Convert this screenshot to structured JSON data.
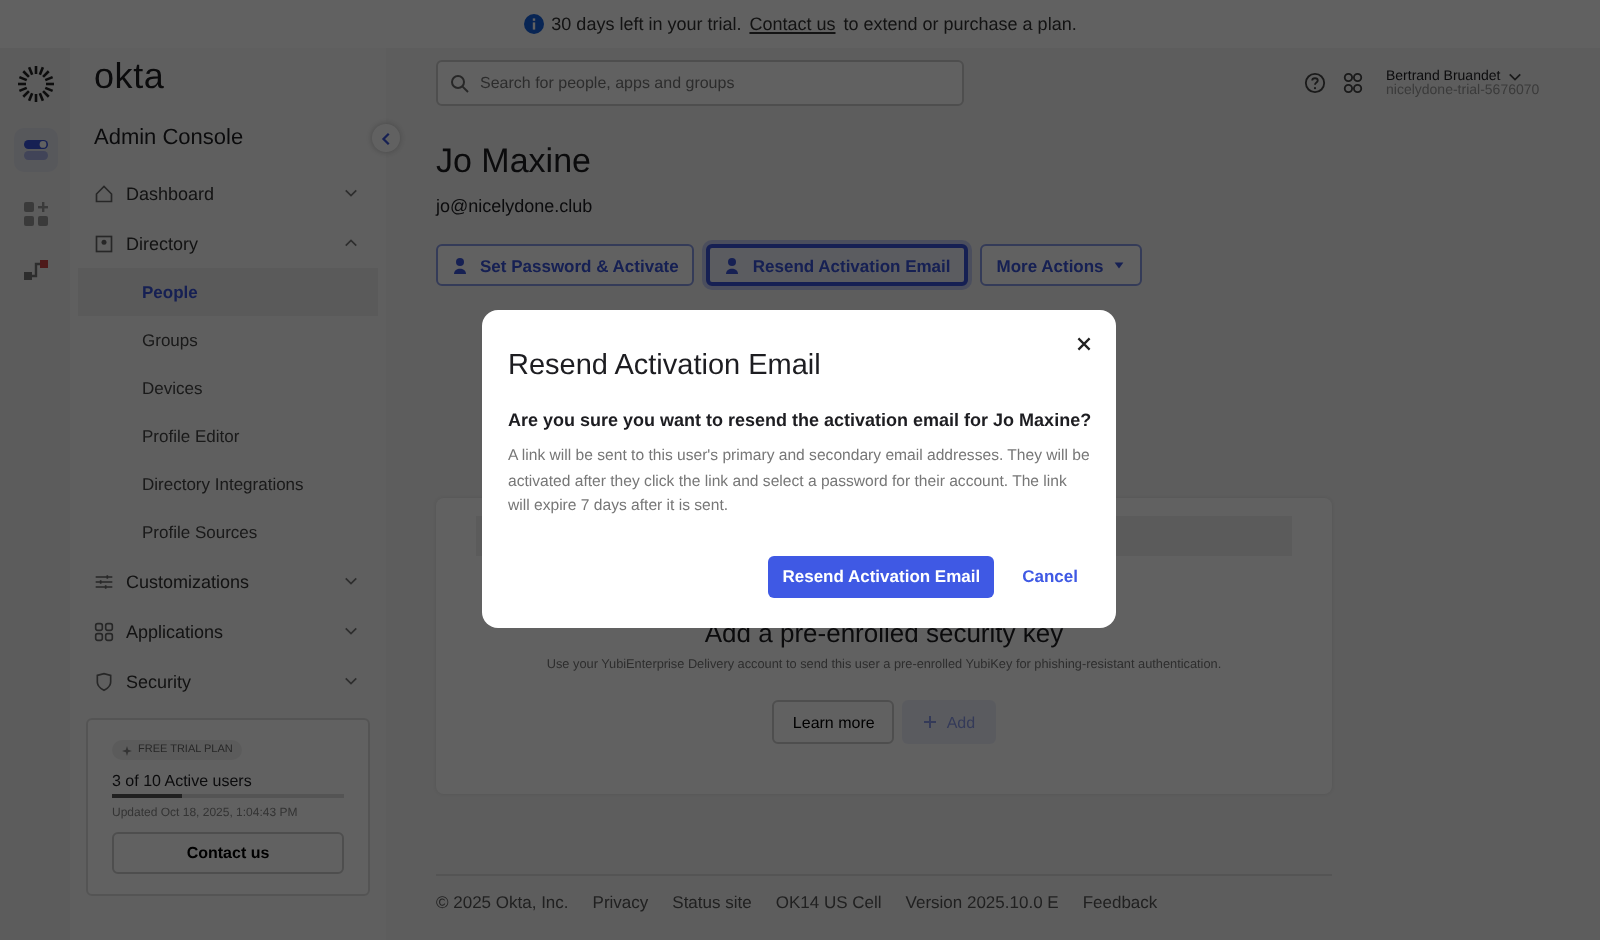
{
  "banner": {
    "text": "30 days left in your trial.",
    "link": "Contact us",
    "tail": "to extend or purchase a plan."
  },
  "brand": {
    "logo": "okta",
    "console": "Admin Console"
  },
  "nav": [
    {
      "label": "Dashboard",
      "expanded": false
    },
    {
      "label": "Directory",
      "expanded": true,
      "children": [
        {
          "label": "People",
          "selected": true
        },
        {
          "label": "Groups",
          "selected": false
        },
        {
          "label": "Devices",
          "selected": false
        },
        {
          "label": "Profile Editor",
          "selected": false
        },
        {
          "label": "Directory Integrations",
          "selected": false
        },
        {
          "label": "Profile Sources",
          "selected": false
        }
      ]
    },
    {
      "label": "Customizations",
      "expanded": false
    },
    {
      "label": "Applications",
      "expanded": false
    },
    {
      "label": "Security",
      "expanded": false
    }
  ],
  "trial": {
    "badge": "FREE TRIAL PLAN",
    "users": "3 of 10 Active users",
    "level": 0.3,
    "updated": "Updated Oct 18, 2025, 1:04:43 PM",
    "button": "Contact us"
  },
  "search": {
    "placeholder": "Search for people, apps and groups"
  },
  "user": {
    "name": "Bertrand Bruandet",
    "org": "nicelydone-trial-5676070"
  },
  "person": {
    "name": "Jo Maxine",
    "email": "jo@nicelydone.club"
  },
  "actions": [
    {
      "label": "Set Password & Activate",
      "kind": "person",
      "focused": false
    },
    {
      "label": "Resend Activation Email",
      "kind": "person",
      "focused": true
    },
    {
      "label": "More Actions",
      "kind": "menu",
      "focused": false
    }
  ],
  "card": {
    "title": "Add a pre-enrolled security key",
    "text": "Use your YubiEnterprise Delivery account to send this user a pre-enrolled YubiKey for phishing-resistant authentication.",
    "learn": "Learn more",
    "add": {
      "label": "Add",
      "disabled": true
    }
  },
  "footer": [
    "© 2025 Okta, Inc.",
    "Privacy",
    "Status site",
    "OK14 US Cell",
    "Version 2025.10.0 E",
    "Feedback"
  ],
  "dialog": {
    "title": "Resend Activation Email",
    "question": "Are you sure you want to resend the activation email for Jo Maxine?",
    "body": "A link will be sent to this user's primary and secondary email addresses. They will be activated after they click the link and select a password for their account. The link will expire 7 days after it is sent.",
    "primary": "Resend Activation Email",
    "cancel": "Cancel"
  }
}
